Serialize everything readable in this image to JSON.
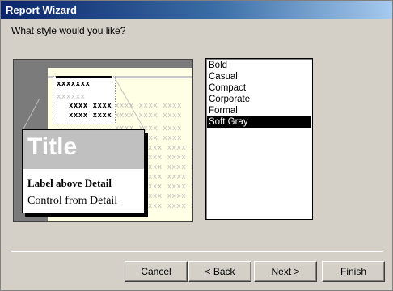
{
  "window": {
    "title": "Report Wizard"
  },
  "prompt": "What style would you like?",
  "preview": {
    "title_text": "Title",
    "label_text": "Label above Detail",
    "control_text": "Control from Detail",
    "header_placeholder": "xxxxxxx",
    "ghost_header": "xxxxxx",
    "detail_pair": "xxxx xxxx",
    "ghost_detail": "xxxx xxxx xxxx"
  },
  "styles": {
    "items": [
      "Bold",
      "Casual",
      "Compact",
      "Corporate",
      "Formal",
      "Soft Gray"
    ],
    "selected": "Soft Gray"
  },
  "buttons": {
    "cancel": "Cancel",
    "back_mnemonic": "B",
    "back_rest": "ack",
    "back_prefix": "< ",
    "next_mnemonic": "N",
    "next_rest": "ext >",
    "finish_mnemonic": "F",
    "finish_rest": "inish"
  },
  "colors": {
    "title_gradient_start": "#0a246a",
    "selection": "#000000",
    "preview_bg": "#ffffe5"
  }
}
